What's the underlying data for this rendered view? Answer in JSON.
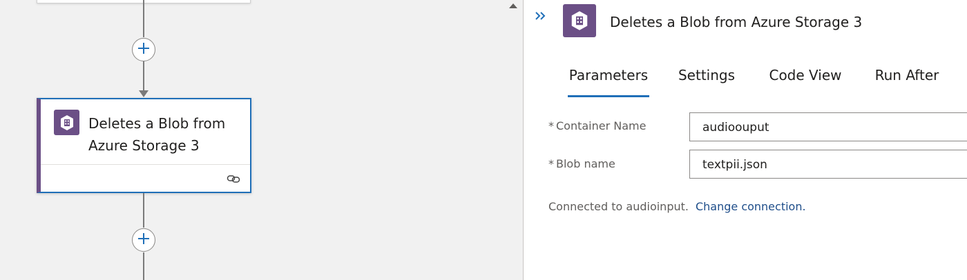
{
  "canvas": {
    "action_card": {
      "title": "Deletes a Blob from Azure Storage 3",
      "icon": "blob-storage-icon",
      "accent_color": "#6b4f86",
      "selected_border_color": "#1f6fb8"
    },
    "add_step_icon": "plus-icon",
    "card_footer_icon": "link-icon"
  },
  "panel": {
    "title": "Deletes a Blob from Azure Storage 3",
    "collapse_icon": "double-chevron-right-icon",
    "icon": "blob-storage-icon",
    "tabs": [
      {
        "label": "Parameters",
        "active": true
      },
      {
        "label": "Settings",
        "active": false
      },
      {
        "label": "Code View",
        "active": false
      },
      {
        "label": "Run After",
        "active": false
      }
    ],
    "fields": [
      {
        "required_mark": "*",
        "label": "Container Name",
        "value": "audioouput"
      },
      {
        "required_mark": "*",
        "label": "Blob name",
        "value": "textpii.json"
      }
    ],
    "connection_text": "Connected to audioinput.",
    "change_connection_label": "Change connection."
  }
}
